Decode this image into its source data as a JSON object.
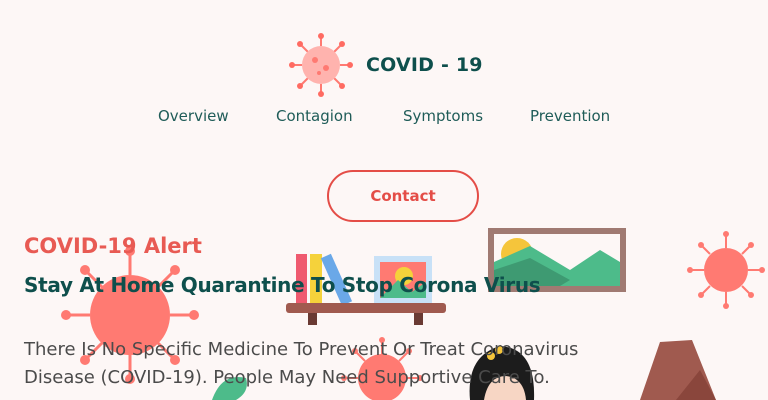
{
  "brand": {
    "name": "COVID - 19",
    "logo_icon": "virus-icon"
  },
  "nav": {
    "items": [
      {
        "label": "Overview"
      },
      {
        "label": "Contagion"
      },
      {
        "label": "Symptoms"
      },
      {
        "label": "Prevention"
      }
    ]
  },
  "cta": {
    "contact_label": "Contact"
  },
  "hero": {
    "alert_title": "COVID-19 Alert",
    "headline": "Stay At Home Quarantine To Stop Corona Virus",
    "body": "There Is No Specific Medicine To Prevent Or Treat Coronavirus Disease (COVID-19). People May Need Supportive Care To."
  },
  "colors": {
    "accent": "#e44d47",
    "brand_teal": "#0e4f4c",
    "virus_coral": "#ff7a72",
    "background": "#fdf7f6"
  },
  "illustrations": [
    "virus-icon",
    "bookshelf-illustration",
    "landscape-painting-illustration",
    "woman-illustration",
    "plant-illustration"
  ]
}
